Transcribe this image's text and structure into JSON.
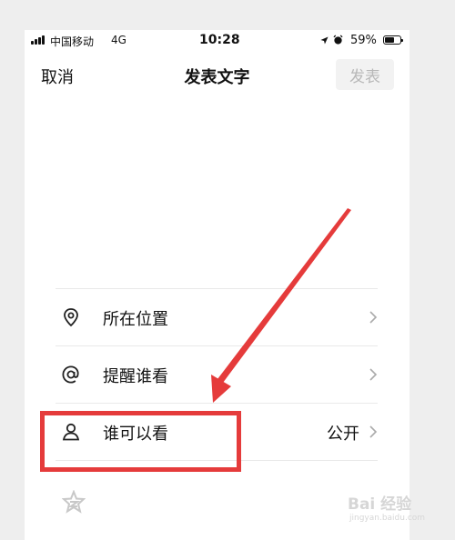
{
  "status_bar": {
    "carrier": "中国移动",
    "network": "4G",
    "time": "10:28",
    "battery_percent": "59%",
    "battery_level": 0.59,
    "icons": [
      "signal-icon",
      "location-arrow-icon",
      "alarm-icon",
      "battery-icon"
    ]
  },
  "nav": {
    "cancel_label": "取消",
    "title": "发表文字",
    "publish_label": "发表"
  },
  "options": [
    {
      "label": "所在位置",
      "icon": "location-pin-icon",
      "value": ""
    },
    {
      "label": "提醒谁看",
      "icon": "at-sign-icon",
      "value": ""
    },
    {
      "label": "谁可以看",
      "icon": "person-icon",
      "value": "公开"
    }
  ],
  "extra_icon": "star-badge-icon",
  "annotation": {
    "color": "#e53b3b"
  },
  "watermark": {
    "brand": "Bai 经验",
    "url": "jingyan.baidu.com"
  },
  "colors": {
    "publish_disabled_bg": "#f2f2f2",
    "publish_disabled_text": "#b8b8b8",
    "divider": "#e9e9e9"
  }
}
